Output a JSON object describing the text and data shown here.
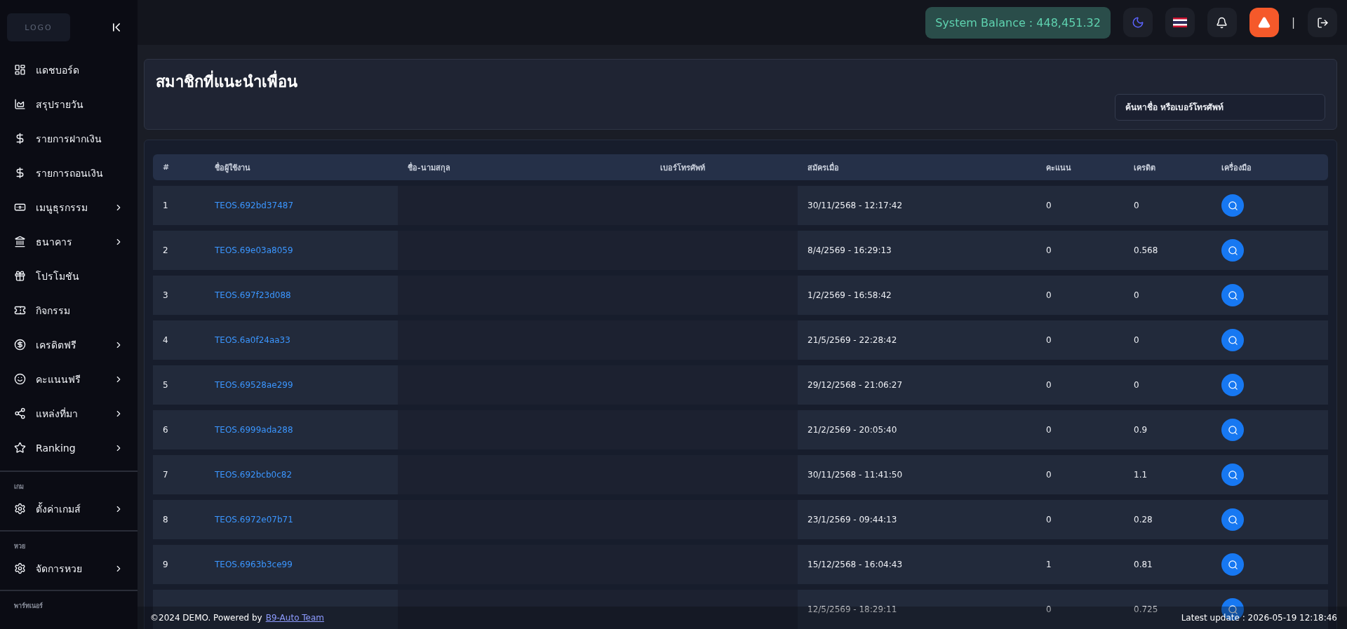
{
  "sidebar": {
    "logo": "LOGO",
    "items": [
      {
        "label": "แดชบอร์ด",
        "expandable": false
      },
      {
        "label": "สรุปรายวัน",
        "expandable": false
      },
      {
        "label": "รายการฝากเงิน",
        "expandable": false
      },
      {
        "label": "รายการถอนเงิน",
        "expandable": false
      },
      {
        "label": "เมนูธุรกรรม",
        "expandable": true
      },
      {
        "label": "ธนาคาร",
        "expandable": true
      },
      {
        "label": "โปรโมชัน",
        "expandable": false
      },
      {
        "label": "กิจกรรม",
        "expandable": false
      },
      {
        "label": "เครดิตฟรี",
        "expandable": true
      },
      {
        "label": "คะแนนฟรี",
        "expandable": true
      },
      {
        "label": "แหล่งที่มา",
        "expandable": true
      },
      {
        "label": "Ranking",
        "expandable": true
      }
    ],
    "sections": [
      {
        "title": "เกม",
        "items": [
          {
            "label": "ตั้งค่าเกมส์",
            "expandable": true
          }
        ]
      },
      {
        "title": "หวย",
        "items": [
          {
            "label": "จัดการหวย",
            "expandable": true
          }
        ]
      },
      {
        "title": "พาร์ทเนอร์"
      }
    ]
  },
  "header": {
    "balance": "System Balance : 448,451.32",
    "separator": "|"
  },
  "page": {
    "title": "สมาชิกที่แนะนำเพื่อน",
    "search": {
      "placeholder": "ค้นหาชื่อ หรือเบอร์โทรศัพท์"
    }
  },
  "table": {
    "columns": [
      "#",
      "ชื่อผู้ใช้งาน",
      "ชื่อ-นามสกุล",
      "เบอร์โทรศัพท์",
      "สมัครเมื่อ",
      "คะแนน",
      "เครดิต",
      "เครื่องมือ"
    ],
    "rows": [
      {
        "number": "1",
        "username": "TEOS.692bd37487",
        "registered": "30/11/2568 - 12:17:42",
        "points": "0",
        "credit": "0"
      },
      {
        "number": "2",
        "username": "TEOS.69e03a8059",
        "registered": "8/4/2569 - 16:29:13",
        "points": "0",
        "credit": "0.568"
      },
      {
        "number": "3",
        "username": "TEOS.697f23d088",
        "registered": "1/2/2569 - 16:58:42",
        "points": "0",
        "credit": "0"
      },
      {
        "number": "4",
        "username": "TEOS.6a0f24aa33",
        "registered": "21/5/2569 - 22:28:42",
        "points": "0",
        "credit": "0"
      },
      {
        "number": "5",
        "username": "TEOS.69528ae299",
        "registered": "29/12/2568 - 21:06:27",
        "points": "0",
        "credit": "0"
      },
      {
        "number": "6",
        "username": "TEOS.6999ada288",
        "registered": "21/2/2569 - 20:05:40",
        "points": "0",
        "credit": "0.9"
      },
      {
        "number": "7",
        "username": "TEOS.692bcb0c82",
        "registered": "30/11/2568 - 11:41:50",
        "points": "0",
        "credit": "1.1"
      },
      {
        "number": "8",
        "username": "TEOS.6972e07b71",
        "registered": "23/1/2569 - 09:44:13",
        "points": "0",
        "credit": "0.28"
      },
      {
        "number": "9",
        "username": "TEOS.6963b3ce99",
        "registered": "15/12/2568 - 16:04:43",
        "points": "1",
        "credit": "0.81"
      },
      {
        "registered": "12/5/2569 - 18:29:11",
        "points": "0",
        "credit": "0.725"
      }
    ]
  },
  "footer": {
    "copyright": "©2024 DEMO. Powered by",
    "link": "B9-Auto Team",
    "update": "Latest update : 2026-05-19 12:18:46"
  }
}
